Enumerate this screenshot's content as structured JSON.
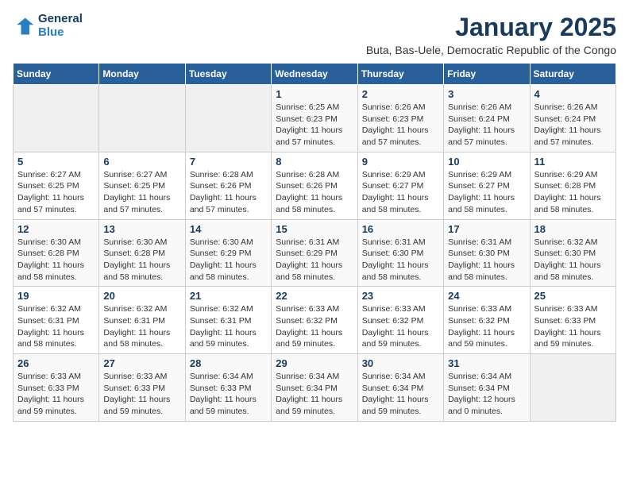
{
  "logo": {
    "line1": "General",
    "line2": "Blue"
  },
  "title": "January 2025",
  "subtitle": "Buta, Bas-Uele, Democratic Republic of the Congo",
  "days_header": [
    "Sunday",
    "Monday",
    "Tuesday",
    "Wednesday",
    "Thursday",
    "Friday",
    "Saturday"
  ],
  "weeks": [
    [
      {
        "day": "",
        "info": ""
      },
      {
        "day": "",
        "info": ""
      },
      {
        "day": "",
        "info": ""
      },
      {
        "day": "1",
        "info": "Sunrise: 6:25 AM\nSunset: 6:23 PM\nDaylight: 11 hours and 57 minutes."
      },
      {
        "day": "2",
        "info": "Sunrise: 6:26 AM\nSunset: 6:23 PM\nDaylight: 11 hours and 57 minutes."
      },
      {
        "day": "3",
        "info": "Sunrise: 6:26 AM\nSunset: 6:24 PM\nDaylight: 11 hours and 57 minutes."
      },
      {
        "day": "4",
        "info": "Sunrise: 6:26 AM\nSunset: 6:24 PM\nDaylight: 11 hours and 57 minutes."
      }
    ],
    [
      {
        "day": "5",
        "info": "Sunrise: 6:27 AM\nSunset: 6:25 PM\nDaylight: 11 hours and 57 minutes."
      },
      {
        "day": "6",
        "info": "Sunrise: 6:27 AM\nSunset: 6:25 PM\nDaylight: 11 hours and 57 minutes."
      },
      {
        "day": "7",
        "info": "Sunrise: 6:28 AM\nSunset: 6:26 PM\nDaylight: 11 hours and 57 minutes."
      },
      {
        "day": "8",
        "info": "Sunrise: 6:28 AM\nSunset: 6:26 PM\nDaylight: 11 hours and 58 minutes."
      },
      {
        "day": "9",
        "info": "Sunrise: 6:29 AM\nSunset: 6:27 PM\nDaylight: 11 hours and 58 minutes."
      },
      {
        "day": "10",
        "info": "Sunrise: 6:29 AM\nSunset: 6:27 PM\nDaylight: 11 hours and 58 minutes."
      },
      {
        "day": "11",
        "info": "Sunrise: 6:29 AM\nSunset: 6:28 PM\nDaylight: 11 hours and 58 minutes."
      }
    ],
    [
      {
        "day": "12",
        "info": "Sunrise: 6:30 AM\nSunset: 6:28 PM\nDaylight: 11 hours and 58 minutes."
      },
      {
        "day": "13",
        "info": "Sunrise: 6:30 AM\nSunset: 6:28 PM\nDaylight: 11 hours and 58 minutes."
      },
      {
        "day": "14",
        "info": "Sunrise: 6:30 AM\nSunset: 6:29 PM\nDaylight: 11 hours and 58 minutes."
      },
      {
        "day": "15",
        "info": "Sunrise: 6:31 AM\nSunset: 6:29 PM\nDaylight: 11 hours and 58 minutes."
      },
      {
        "day": "16",
        "info": "Sunrise: 6:31 AM\nSunset: 6:30 PM\nDaylight: 11 hours and 58 minutes."
      },
      {
        "day": "17",
        "info": "Sunrise: 6:31 AM\nSunset: 6:30 PM\nDaylight: 11 hours and 58 minutes."
      },
      {
        "day": "18",
        "info": "Sunrise: 6:32 AM\nSunset: 6:30 PM\nDaylight: 11 hours and 58 minutes."
      }
    ],
    [
      {
        "day": "19",
        "info": "Sunrise: 6:32 AM\nSunset: 6:31 PM\nDaylight: 11 hours and 58 minutes."
      },
      {
        "day": "20",
        "info": "Sunrise: 6:32 AM\nSunset: 6:31 PM\nDaylight: 11 hours and 58 minutes."
      },
      {
        "day": "21",
        "info": "Sunrise: 6:32 AM\nSunset: 6:31 PM\nDaylight: 11 hours and 59 minutes."
      },
      {
        "day": "22",
        "info": "Sunrise: 6:33 AM\nSunset: 6:32 PM\nDaylight: 11 hours and 59 minutes."
      },
      {
        "day": "23",
        "info": "Sunrise: 6:33 AM\nSunset: 6:32 PM\nDaylight: 11 hours and 59 minutes."
      },
      {
        "day": "24",
        "info": "Sunrise: 6:33 AM\nSunset: 6:32 PM\nDaylight: 11 hours and 59 minutes."
      },
      {
        "day": "25",
        "info": "Sunrise: 6:33 AM\nSunset: 6:33 PM\nDaylight: 11 hours and 59 minutes."
      }
    ],
    [
      {
        "day": "26",
        "info": "Sunrise: 6:33 AM\nSunset: 6:33 PM\nDaylight: 11 hours and 59 minutes."
      },
      {
        "day": "27",
        "info": "Sunrise: 6:33 AM\nSunset: 6:33 PM\nDaylight: 11 hours and 59 minutes."
      },
      {
        "day": "28",
        "info": "Sunrise: 6:34 AM\nSunset: 6:33 PM\nDaylight: 11 hours and 59 minutes."
      },
      {
        "day": "29",
        "info": "Sunrise: 6:34 AM\nSunset: 6:34 PM\nDaylight: 11 hours and 59 minutes."
      },
      {
        "day": "30",
        "info": "Sunrise: 6:34 AM\nSunset: 6:34 PM\nDaylight: 11 hours and 59 minutes."
      },
      {
        "day": "31",
        "info": "Sunrise: 6:34 AM\nSunset: 6:34 PM\nDaylight: 12 hours and 0 minutes."
      },
      {
        "day": "",
        "info": ""
      }
    ]
  ]
}
